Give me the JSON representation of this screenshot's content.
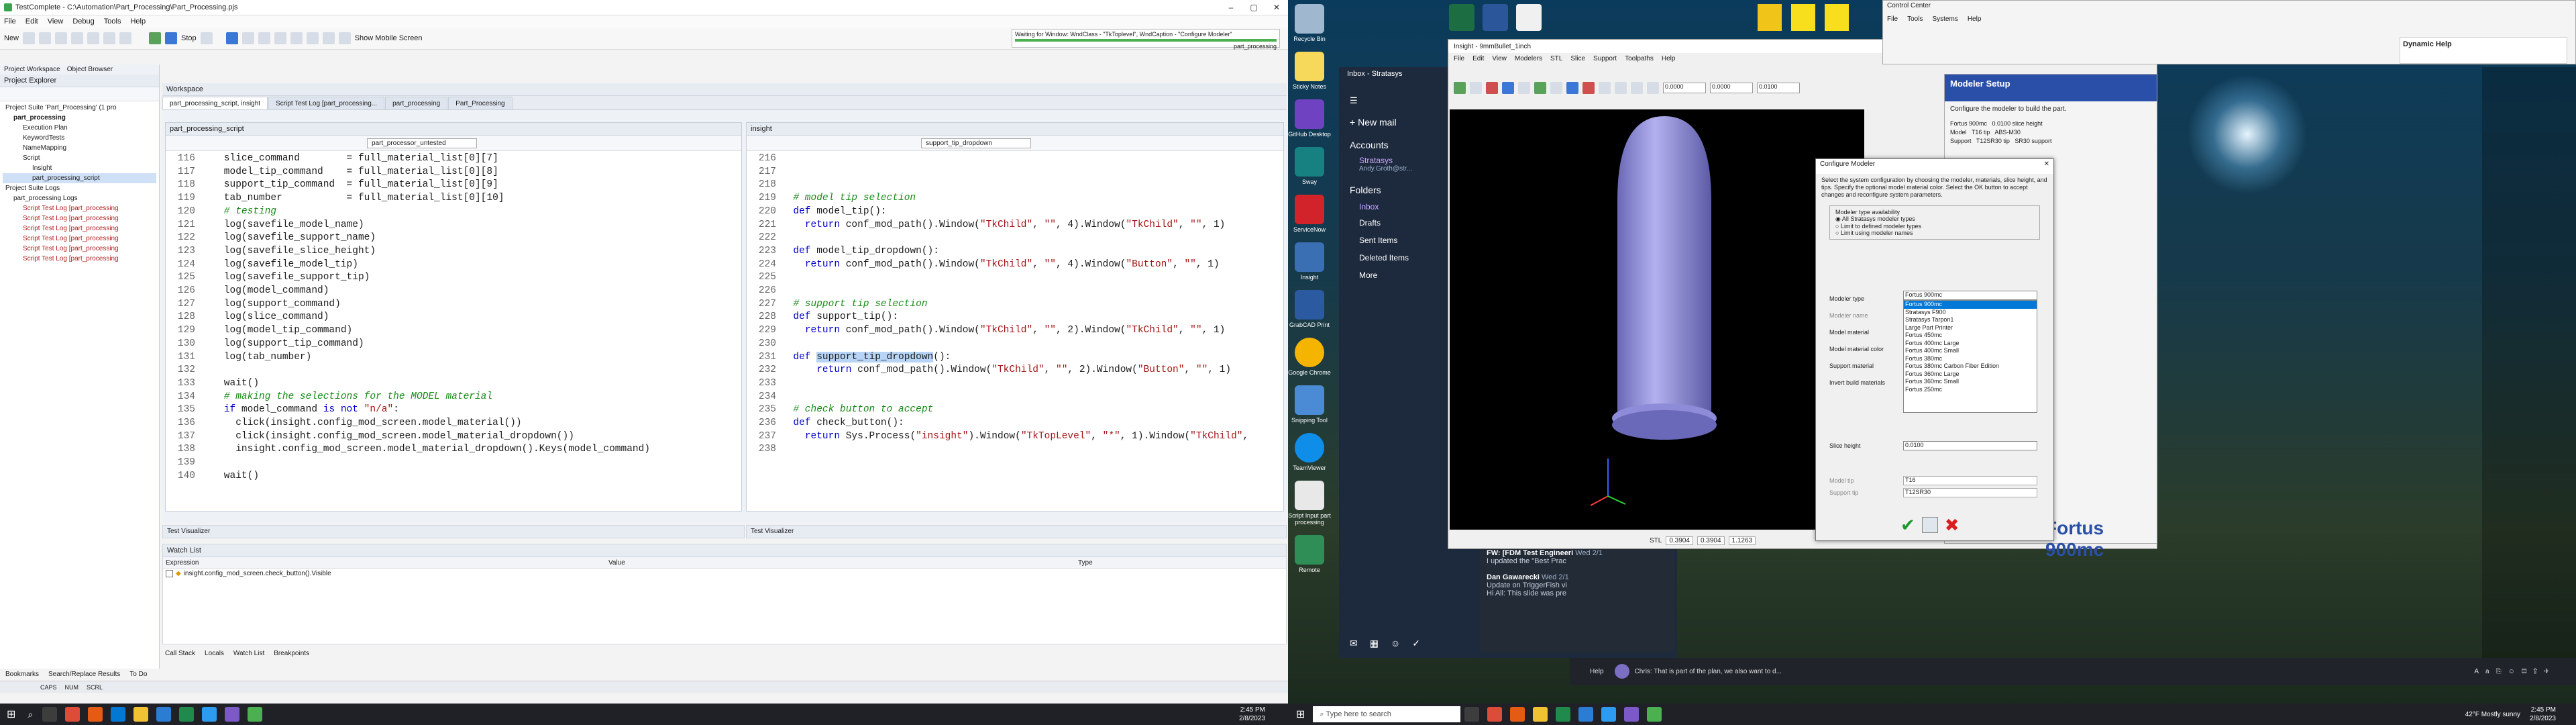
{
  "ide": {
    "title": "TestComplete - C:\\Automation\\Part_Processing\\Part_Processing.pjs",
    "menu": [
      "File",
      "Edit",
      "View",
      "Debug",
      "Tools",
      "Help"
    ],
    "toolbar_new": "New",
    "toolbar_stop": "Stop",
    "toolbar_mobile": "Show Mobile Screen",
    "waiting_text": "Waiting for Window: WndClass - \"TkToplevel\", WndCaption - \"Configure Modeler\"",
    "waiting_sub": "part_processing",
    "project_tabs": [
      "Project Workspace",
      "Object Browser"
    ],
    "explorer_title": "Project Explorer",
    "tree": [
      "Project Suite 'Part_Processing' (1 pro",
      "part_processing",
      "Execution Plan",
      "KeywordTests",
      "NameMapping",
      "Script",
      "Insight",
      "part_processing_script",
      "Project Suite Logs",
      "part_processing Logs",
      "Script Test Log [part_processing",
      "Script Test Log [part_processing",
      "Script Test Log [part_processing",
      "Script Test Log [part_processing",
      "Script Test Log [part_processing",
      "Script Test Log [part_processing"
    ],
    "workspace_title": "Workspace",
    "workspace_tabs": [
      "part_processing_script, insight",
      "Script Test Log [part_processing...",
      "part_processing",
      "Part_Processing"
    ],
    "left_editor": {
      "title": "part_processing_script",
      "dropdown": "part_processor_untested",
      "lines": [
        {
          "n": "116",
          "t": "    slice_command        = full_material_list[0][7]"
        },
        {
          "n": "117",
          "t": "    model_tip_command    = full_material_list[0][8]"
        },
        {
          "n": "118",
          "t": "    support_tip_command  = full_material_list[0][9]"
        },
        {
          "n": "119",
          "t": "    tab_number           = full_material_list[0][10]"
        },
        {
          "n": "120",
          "t": "    # testing"
        },
        {
          "n": "121",
          "t": "    log(savefile_model_name)"
        },
        {
          "n": "122",
          "t": "    log(savefile_support_name)"
        },
        {
          "n": "123",
          "t": "    log(savefile_slice_height)"
        },
        {
          "n": "124",
          "t": "    log(savefile_model_tip)"
        },
        {
          "n": "125",
          "t": "    log(savefile_support_tip)"
        },
        {
          "n": "126",
          "t": "    log(model_command)"
        },
        {
          "n": "127",
          "t": "    log(support_command)"
        },
        {
          "n": "128",
          "t": "    log(slice_command)"
        },
        {
          "n": "129",
          "t": "    log(model_tip_command)"
        },
        {
          "n": "130",
          "t": "    log(support_tip_command)"
        },
        {
          "n": "131",
          "t": "    log(tab_number)"
        },
        {
          "n": "132",
          "t": ""
        },
        {
          "n": "133",
          "t": "    wait()"
        },
        {
          "n": "134",
          "t": "    # making the selections for the MODEL material"
        },
        {
          "n": "135",
          "t": "    if model_command is not \"n/a\":"
        },
        {
          "n": "136",
          "t": "      click(insight.config_mod_screen.model_material())"
        },
        {
          "n": "137",
          "t": "      click(insight.config_mod_screen.model_material_dropdown())"
        },
        {
          "n": "138",
          "t": "      insight.config_mod_screen.model_material_dropdown().Keys(model_command)"
        },
        {
          "n": "139",
          "t": ""
        },
        {
          "n": "140",
          "t": "    wait()"
        }
      ]
    },
    "right_editor": {
      "title": "insight",
      "dropdown": "support_tip_dropdown",
      "lines": [
        {
          "n": "216",
          "t": ""
        },
        {
          "n": "217",
          "t": ""
        },
        {
          "n": "218",
          "t": ""
        },
        {
          "n": "219",
          "t": "  # model tip selection"
        },
        {
          "n": "220",
          "t": "  def model_tip():"
        },
        {
          "n": "221",
          "t": "    return conf_mod_path().Window(\"TkChild\", \"\", 4).Window(\"TkChild\", \"\", 1)"
        },
        {
          "n": "222",
          "t": ""
        },
        {
          "n": "223",
          "t": "  def model_tip_dropdown():"
        },
        {
          "n": "224",
          "t": "    return conf_mod_path().Window(\"TkChild\", \"\", 4).Window(\"Button\", \"\", 1)"
        },
        {
          "n": "225",
          "t": ""
        },
        {
          "n": "226",
          "t": ""
        },
        {
          "n": "227",
          "t": "  # support tip selection"
        },
        {
          "n": "228",
          "t": "  def support_tip():"
        },
        {
          "n": "229",
          "t": "    return conf_mod_path().Window(\"TkChild\", \"\", 2).Window(\"TkChild\", \"\", 1)"
        },
        {
          "n": "230",
          "t": ""
        },
        {
          "n": "231",
          "t": "  def support_tip_dropdown():"
        },
        {
          "n": "232",
          "t": "      return conf_mod_path().Window(\"TkChild\", \"\", 2).Window(\"Button\", \"\", 1)"
        },
        {
          "n": "233",
          "t": ""
        },
        {
          "n": "234",
          "t": ""
        },
        {
          "n": "235",
          "t": "  # check button to accept"
        },
        {
          "n": "236",
          "t": "  def check_button():"
        },
        {
          "n": "237",
          "t": "    return Sys.Process(\"insight\").Window(\"TkTopLevel\", \"*\", 1).Window(\"TkChild\","
        },
        {
          "n": "238",
          "t": ""
        }
      ]
    },
    "visualizer_left": "Test Visualizer",
    "visualizer_right": "Test Visualizer",
    "watch_title": "Watch List",
    "watch_headers": [
      "Expression",
      "Value",
      "Type"
    ],
    "watch_row": "insight.config_mod_screen.check_button().Visible",
    "bottom_tabs": [
      "Call Stack",
      "Locals",
      "Watch List",
      "Breakpoints"
    ],
    "status_tabs": [
      "Bookmarks",
      "Search/Replace Results",
      "To Do"
    ],
    "status_caps": [
      "CAPS",
      "NUM",
      "SCRL"
    ],
    "taskbar_time": "2:45 PM",
    "taskbar_date": "2/8/2023"
  },
  "desktop": {
    "icons": [
      "Recycle Bin",
      "Sticky Notes",
      "GitHub Desktop",
      "Sway",
      "ServiceNow",
      "Insight",
      "GrabCAD Print",
      "Google Chrome",
      "Snipping Tool",
      "TeamViewer",
      "Script Input part processing",
      "Remote"
    ],
    "mail": {
      "account": "Inbox - Stratasys",
      "new_mail": "New mail",
      "accounts": "Accounts",
      "stratasys": "Stratasys",
      "email": "Andy.Groth@str...",
      "folders": "Folders",
      "items": [
        "Inbox",
        "Drafts",
        "Sent Items",
        "Deleted Items",
        "More"
      ],
      "msgs": [
        {
          "from": "FW: [FDM Test Engineeri",
          "date": "Wed 2/1",
          "body": "I updated the \"Best Prac"
        },
        {
          "from": "Dan Gawarecki",
          "date": "Wed 2/1",
          "body": "Update on TriggerFish vi"
        },
        {
          "from": "",
          "date": "",
          "body": "Hi All: This slide was pre"
        }
      ]
    },
    "insight": {
      "title": "Insight - 9mmBullet_1inch",
      "menu": [
        "File",
        "Edit",
        "View",
        "Modelers",
        "STL",
        "Slice",
        "Support",
        "Toolpaths",
        "Help"
      ],
      "coords": [
        "0.0000",
        "0.0000",
        "0.0100"
      ],
      "status_label": "STL",
      "status_vals": [
        "0.3904",
        "0.3904",
        "1.1263"
      ]
    },
    "modeler_setup": {
      "title": "Modeler Setup",
      "hint": "Configure the modeler to build the part.",
      "rows": [
        [
          "Fortus 900mc",
          "0.0100 slice height"
        ],
        [
          "Model",
          "T16 tip",
          "ABS-M30"
        ],
        [
          "Support",
          "T12SR30 tip",
          "SR30 support"
        ]
      ],
      "big_label": "Fortus 900mc"
    },
    "configure": {
      "title": "Configure Modeler",
      "desc": "Select the system configuration by choosing the modeler, materials, slice height, and tips. Specify the optional model material color. Select the OK button to accept changes and reconfigure system parameters.",
      "group": "Modeler type availability",
      "radios": [
        "All Stratasys modeler types",
        "Limit to defined modeler types",
        "Limit using modeler names"
      ],
      "labels": [
        "Modeler type",
        "Modeler name",
        "Model material",
        "Model material color",
        "Support material",
        "Invert build materials",
        "Slice height",
        "Model tip",
        "Support tip"
      ],
      "type_value": "Fortus 900mc",
      "list": [
        "Fortus 900mc",
        "Stratasys F900",
        "Stratasys Tarpon1",
        "Large Part Printer",
        "Fortus 450mc",
        "Fortus 400mc Large",
        "Fortus 400mc Small",
        "Fortus 380mc",
        "Fortus 380mc Carbon Fiber Edition",
        "Fortus 360mc Large",
        "Fortus 360mc Small",
        "Fortus 250mc"
      ],
      "slice_value": "0.0100",
      "model_tip": "T16",
      "support_tip": "T12SR30"
    },
    "control_center": {
      "title": "Control Center",
      "menu": [
        "File",
        "Tools",
        "Systems",
        "Help"
      ]
    },
    "dynamic_help": "Dynamic Help",
    "chat_text": "Chris: That is part of the plan, we also want to d...",
    "weather": "42°F  Mostly sunny",
    "search_placeholder": "Type here to search",
    "time": "2:45 PM",
    "date": "2/8/2023",
    "help_label": "Help"
  },
  "colors": {
    "ide_accent": "#3b78d6",
    "mail_bg": "#1d2a3d",
    "insight_view": "#000000",
    "bullet": "#8e8cd8"
  }
}
